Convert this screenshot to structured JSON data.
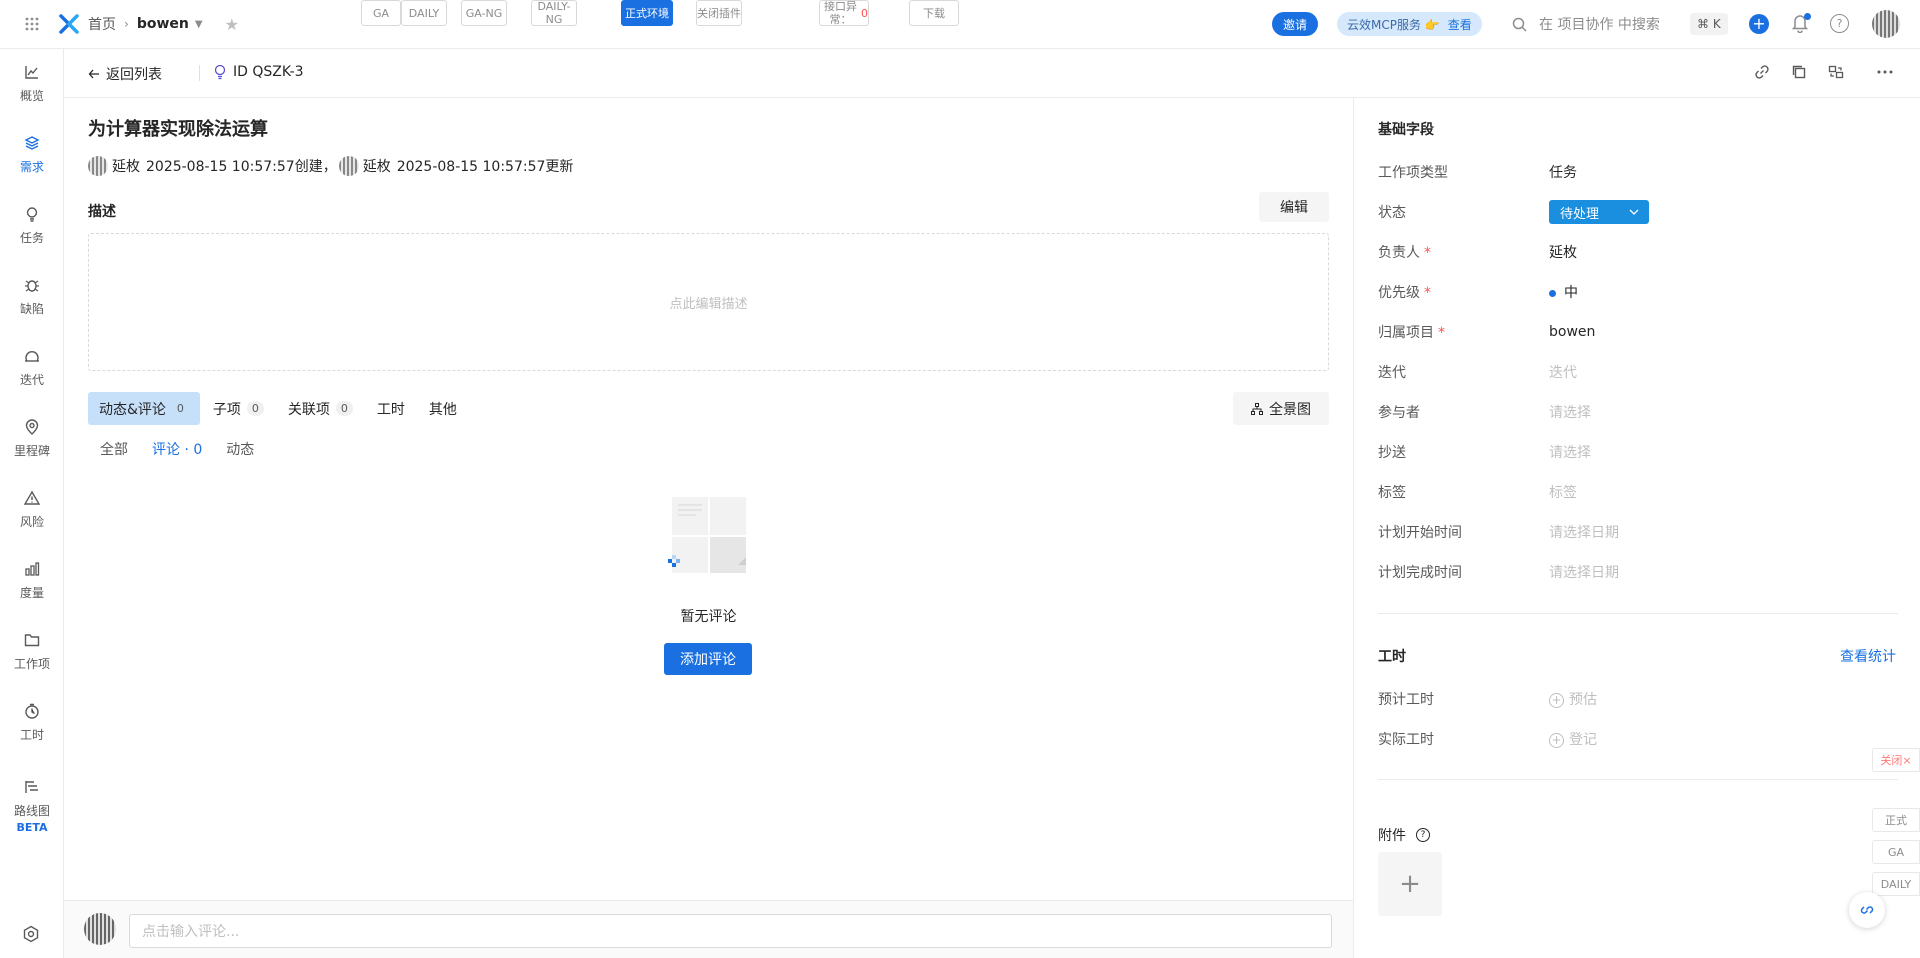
{
  "topbar": {
    "home": "首页",
    "project": "bowen",
    "env_chips": [
      {
        "label": "GA",
        "active": false
      },
      {
        "label": "DAILY",
        "active": false
      },
      {
        "label": "GA-NG",
        "active": false
      },
      {
        "label": "DAILY-NG",
        "active": false
      },
      {
        "label": "正式环境",
        "active": true
      },
      {
        "label": "关闭插件",
        "active": false
      },
      {
        "label": "接口异常：",
        "count": "0",
        "active": false
      },
      {
        "label": "下载",
        "active": false
      }
    ],
    "invite": "邀请",
    "mcp_label": "云效MCP服务 👉",
    "mcp_link": "查看",
    "search_placeholder": "在 项目协作 中搜索",
    "shortcut": "⌘ K"
  },
  "leftnav": {
    "items": [
      {
        "label": "概览",
        "icon": "chart-line-icon",
        "active": false
      },
      {
        "label": "需求",
        "icon": "layers-icon",
        "active": true
      },
      {
        "label": "任务",
        "icon": "bulb-icon",
        "active": false
      },
      {
        "label": "缺陷",
        "icon": "bug-icon",
        "active": false
      },
      {
        "label": "迭代",
        "icon": "iteration-icon",
        "active": false
      },
      {
        "label": "里程碑",
        "icon": "location-pin-icon",
        "active": false
      },
      {
        "label": "风险",
        "icon": "warning-icon",
        "active": false
      },
      {
        "label": "度量",
        "icon": "bar-chart-icon",
        "active": false
      },
      {
        "label": "工作项",
        "icon": "folder-icon",
        "active": false
      },
      {
        "label": "工时",
        "icon": "timer-icon",
        "active": false
      },
      {
        "label": "路线图",
        "icon": "roadmap-icon",
        "active": false,
        "badge": "BETA"
      }
    ]
  },
  "subhead": {
    "back": "返回列表",
    "id_label": "ID QSZK-3"
  },
  "main": {
    "title": "为计算器实现除法运算",
    "creator": "延枚",
    "created": "2025-08-15 10:57:57创建",
    "separator": "，",
    "updater": "延枚",
    "updated": "2025-08-15 10:57:57更新",
    "desc_label": "描述",
    "edit_button": "编辑",
    "desc_placeholder": "点此编辑描述",
    "tabs": [
      {
        "label": "动态&评论",
        "count": "0",
        "active": true
      },
      {
        "label": "子项",
        "count": "0",
        "active": false
      },
      {
        "label": "关联项",
        "count": "0",
        "active": false
      },
      {
        "label": "工时",
        "count": null,
        "active": false
      },
      {
        "label": "其他",
        "count": null,
        "active": false
      }
    ],
    "overview_button": "全景图",
    "subtabs": [
      {
        "label": "全部",
        "active": false
      },
      {
        "label": "评论 · 0",
        "active": true
      },
      {
        "label": "动态",
        "active": false
      }
    ],
    "empty_text": "暂无评论",
    "add_comment": "添加评论",
    "comment_placeholder": "点击输入评论..."
  },
  "rpanel": {
    "basic_title": "基础字段",
    "fields": [
      {
        "label": "工作项类型",
        "value": "任务",
        "required": false,
        "placeholder": false
      },
      {
        "label": "状态",
        "value": "待处理",
        "required": false,
        "type": "status"
      },
      {
        "label": "负责人",
        "value": "延枚",
        "required": true,
        "placeholder": false
      },
      {
        "label": "优先级",
        "value": "中",
        "required": true,
        "type": "priority"
      },
      {
        "label": "归属项目",
        "value": "bowen",
        "required": true,
        "placeholder": false
      },
      {
        "label": "迭代",
        "value": "迭代",
        "required": false,
        "placeholder": true
      },
      {
        "label": "参与者",
        "value": "请选择",
        "required": false,
        "placeholder": true
      },
      {
        "label": "抄送",
        "value": "请选择",
        "required": false,
        "placeholder": true
      },
      {
        "label": "标签",
        "value": "标签",
        "required": false,
        "placeholder": true
      },
      {
        "label": "计划开始时间",
        "value": "请选择日期",
        "required": false,
        "placeholder": true
      },
      {
        "label": "计划完成时间",
        "value": "请选择日期",
        "required": false,
        "placeholder": true
      }
    ],
    "worktime_title": "工时",
    "stats_link": "查看统计",
    "estimated_label": "预计工时",
    "estimated_action": "预估",
    "actual_label": "实际工时",
    "actual_action": "登记",
    "attach_title": "附件"
  },
  "float_tags": {
    "close": "关闭×",
    "prod": "正式",
    "ga": "GA",
    "daily": "DAILY"
  },
  "colors": {
    "accent": "#1a70e0",
    "status": "#1a8fe0",
    "required": "#ff4d4f"
  }
}
